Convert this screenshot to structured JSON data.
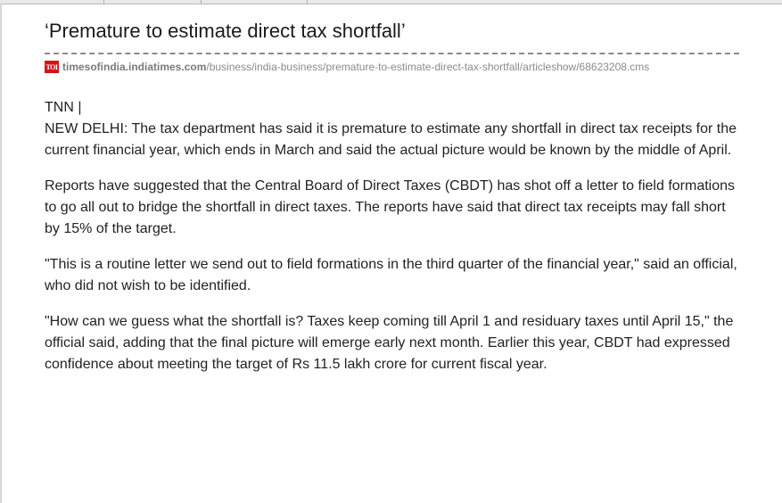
{
  "article": {
    "title": "‘Premature to estimate direct tax shortfall’",
    "source": {
      "icon": "toi-logo-icon",
      "icon_text": "TOI",
      "domain": "timesofindia.indiatimes.com",
      "path": "/business/india-business/premature-to-estimate-direct-tax-shortfall/articleshow/68623208.cms"
    },
    "byline": "TNN |",
    "paragraphs": [
      "NEW DELHI: The tax department has said it is premature to estimate any shortfall in direct tax receipts for the current financial year, which ends in March and said the actual picture would be known by the middle of April.",
      "Reports have suggested that the Central Board of Direct Taxes (CBDT) has shot off a letter to field formations to go all out to bridge the shortfall in direct taxes. The reports have said that direct tax receipts may fall short by 15% of the target.",
      "\"This is a routine letter we send out to field formations in the third quarter of the financial year,\" said an official, who did not wish to be identified.",
      "\"How can we guess what the shortfall is? Taxes keep coming till April 1 and residuary taxes until April 15,\" the official said, adding that the final picture will emerge early next month. Earlier this year, CBDT had expressed confidence about meeting the target of Rs 11.5 lakh crore for current fiscal year."
    ]
  },
  "colors": {
    "toi_red": "#d3141a",
    "text": "#222222",
    "source_grey": "#8a8a8a"
  }
}
